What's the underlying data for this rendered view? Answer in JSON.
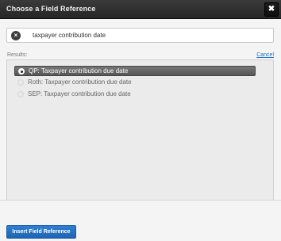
{
  "dialog": {
    "title": "Choose a Field Reference",
    "close_label": "✖"
  },
  "search": {
    "value": "taxpayer contribution date",
    "clear_icon": "clear-circle-icon"
  },
  "results": {
    "label": "Results:",
    "cancel_label": "Cancel",
    "items": [
      {
        "label": "QP: Taxpayer contribution due date",
        "selected": true
      },
      {
        "label": "Roth: Taxpayer contribution due date",
        "selected": false
      },
      {
        "label": "SEP: Taxpayer contribution due date",
        "selected": false
      }
    ]
  },
  "footer": {
    "insert_label": "Insert Field Reference"
  },
  "colors": {
    "titlebar": "#2f2f2f",
    "accent": "#1f64b3",
    "link": "#1a73c8",
    "selected_row": "#666666"
  }
}
